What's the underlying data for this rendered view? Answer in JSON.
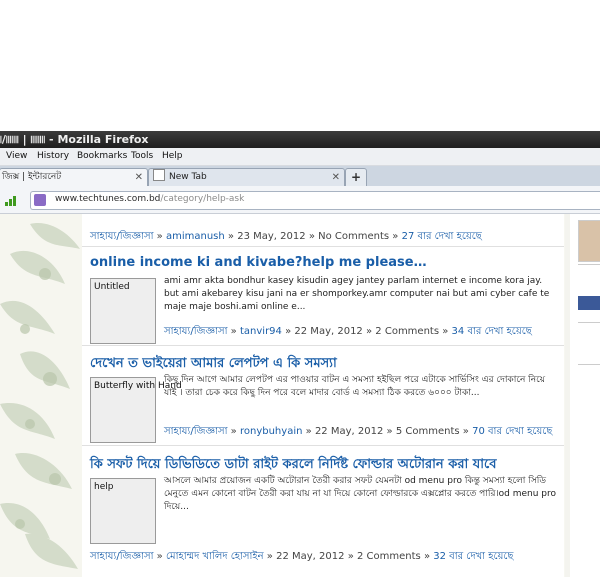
{
  "window": {
    "title": "৷/৷৷৷৷৷৷৷ | ৷৷৷৷৷৷৷৷ - Mozilla Firefox"
  },
  "menu": {
    "view": "View",
    "history": "History",
    "bookmarks": "Bookmarks",
    "tools": "Tools",
    "help": "Help"
  },
  "tabs": [
    {
      "label": "জিক্স | ইন্টারনেট"
    },
    {
      "label": "New Tab"
    }
  ],
  "address": {
    "domain": "www.techtunes.com.bd",
    "path": "/category/help-ask"
  },
  "posts": [
    {
      "category": "সাহায্য/জিজ্ঞাসা",
      "author": "amimanush",
      "date": "23 May, 2012",
      "comments": "No Comments",
      "views": "27 বার দেখা হয়েছে"
    },
    {
      "title": "online income ki and kivabe?help me please…",
      "thumb": "Untitled",
      "excerpt": "ami amr akta bondhur kasey kisudin agey jantey parlam internet e income kora jay. but ami akebarey kisu jani na er shomporkey.amr computer nai but ami cyber cafe te maje maje boshi.ami online e...",
      "category": "সাহায্য/জিজ্ঞাসা",
      "author": "tanvir94",
      "date": "22 May, 2012",
      "comments": "2 Comments",
      "views": "34 বার দেখা হয়েছে"
    },
    {
      "title": "দেখেন ত ভাইয়েরা আমার লেপটপ এ কি সমস্যা",
      "thumb": "Butterfly  with  Hand",
      "excerpt": "কিছু দিন আগে আমার লেপটপ এর পাওয়ার বাটন এ সমস্যা হইছিল পরে এটাকে সার্ভিসিং এর দোকানে নিয়ে যাই । তারা চেক করে কিছু দিন পরে বলে মাদার বোর্ড এ সমস্যা ঠিক করতে ৬০০০ টাকা...",
      "category": "সাহায্য/জিজ্ঞাসা",
      "author": "ronybuhyain",
      "date": "22 May, 2012",
      "comments": "5 Comments",
      "views": "70 বার দেখা হয়েছে"
    },
    {
      "title": "কি সফট দিয়ে ডিভিডিতে ডাটা রাইট করলে নির্দিষ্ট ফোল্ডার অটোরান করা যাবে",
      "thumb": "help",
      "excerpt": "আসলে আমার প্রয়োজন একটি অটোরান তৈরী করার সফট যেমনটা od menu pro কিন্তু সমস্যা হলো সিডি মেনুতে এমন কোনো বাটন তৈরী করা যায় না যা দিয়ে কোনো ফোল্ডারকে এক্সপ্লোর করতে পারি।od menu pro দিয়ে...",
      "category": "সাহায্য/জিজ্ঞাসা",
      "author": "মোহাম্মদ খালিদ হোসাইন",
      "date": "22 May, 2012",
      "comments": "2 Comments",
      "views": "32 বার দেখা হয়েছে"
    }
  ],
  "meta_sep": "»",
  "colors": {
    "link": "#1a5ea8",
    "titlebar": "#2a2a2a",
    "tabbar": "#cdd6e1"
  }
}
